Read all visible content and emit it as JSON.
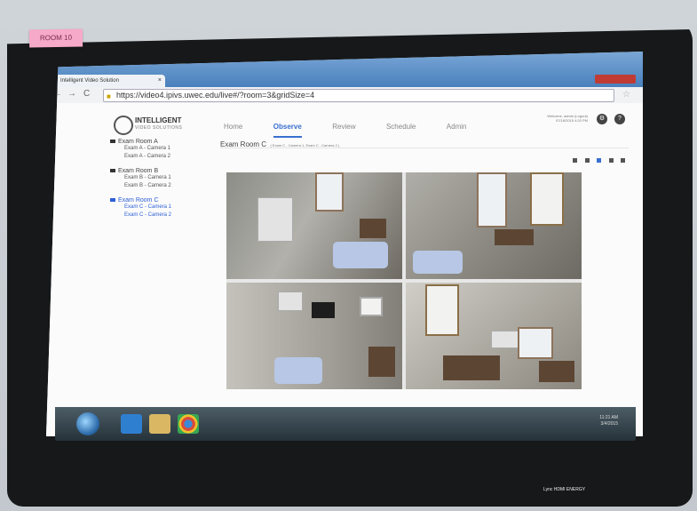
{
  "sticky_note": "ROOM 10",
  "browser": {
    "tab_title": "Intelligent Video Solution",
    "tab_close": "×",
    "back": "←",
    "forward": "→",
    "reload": "C",
    "url": "https://video4.ipivs.uwec.edu/live#/?room=3&gridSize=4"
  },
  "app": {
    "logo_title": "INTELLIGENT",
    "logo_subtitle": "VIDEO SOLUTIONS",
    "nav": [
      "Home",
      "Observe",
      "Review",
      "Schedule",
      "Admin"
    ],
    "active_nav": "Observe",
    "welcome_line1": "Welcome, admin (Logout)",
    "welcome_line2": "07/18/2015 4:20 PM",
    "help_icon": "?",
    "settings_icon": "⚙",
    "main_title": "Exam Room C",
    "main_subtitle": "( Exam C - Camera 1, Exam C - Camera 2 )"
  },
  "rooms": [
    {
      "name": "Exam Room A",
      "cameras": [
        "Exam A - Camera 1",
        "Exam A - Camera 2"
      ]
    },
    {
      "name": "Exam Room B",
      "cameras": [
        "Exam B - Camera 1",
        "Exam B - Camera 2"
      ]
    },
    {
      "name": "Exam Room C",
      "cameras": [
        "Exam C - Camera 1",
        "Exam C - Camera 2"
      ],
      "selected": true
    }
  ],
  "taskbar": {
    "time": "11:21 AM",
    "date": "3/4/2015"
  },
  "bezel_text": "Lync  HDMI  ENERGY"
}
